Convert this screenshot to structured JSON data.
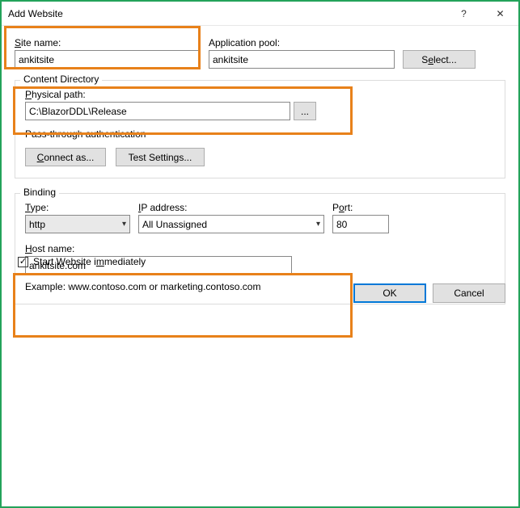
{
  "window": {
    "title": "Add Website",
    "help": "?",
    "close": "✕"
  },
  "siteName": {
    "label": "Site name:",
    "value": "ankitsite"
  },
  "appPool": {
    "label": "Application pool:",
    "value": "ankitsite",
    "selectBtn": "Select..."
  },
  "contentDir": {
    "legend": "Content Directory",
    "pathLabel": "Physical path:",
    "pathValue": "C:\\BlazorDDL\\Release",
    "browse": "...",
    "passThrough": "Pass-through authentication",
    "connectAs": "Connect as...",
    "testSettings": "Test Settings..."
  },
  "binding": {
    "legend": "Binding",
    "typeLabel": "Type:",
    "typeValue": "http",
    "ipLabel": "IP address:",
    "ipValue": "All Unassigned",
    "portLabel": "Port:",
    "portValue": "80",
    "hostLabel": "Host name:",
    "hostValue": "ankitsite.com",
    "example": "Example: www.contoso.com or marketing.contoso.com"
  },
  "startImmediately": {
    "label": "Start Website immediately",
    "checked": "✓"
  },
  "footer": {
    "ok": "OK",
    "cancel": "Cancel"
  }
}
